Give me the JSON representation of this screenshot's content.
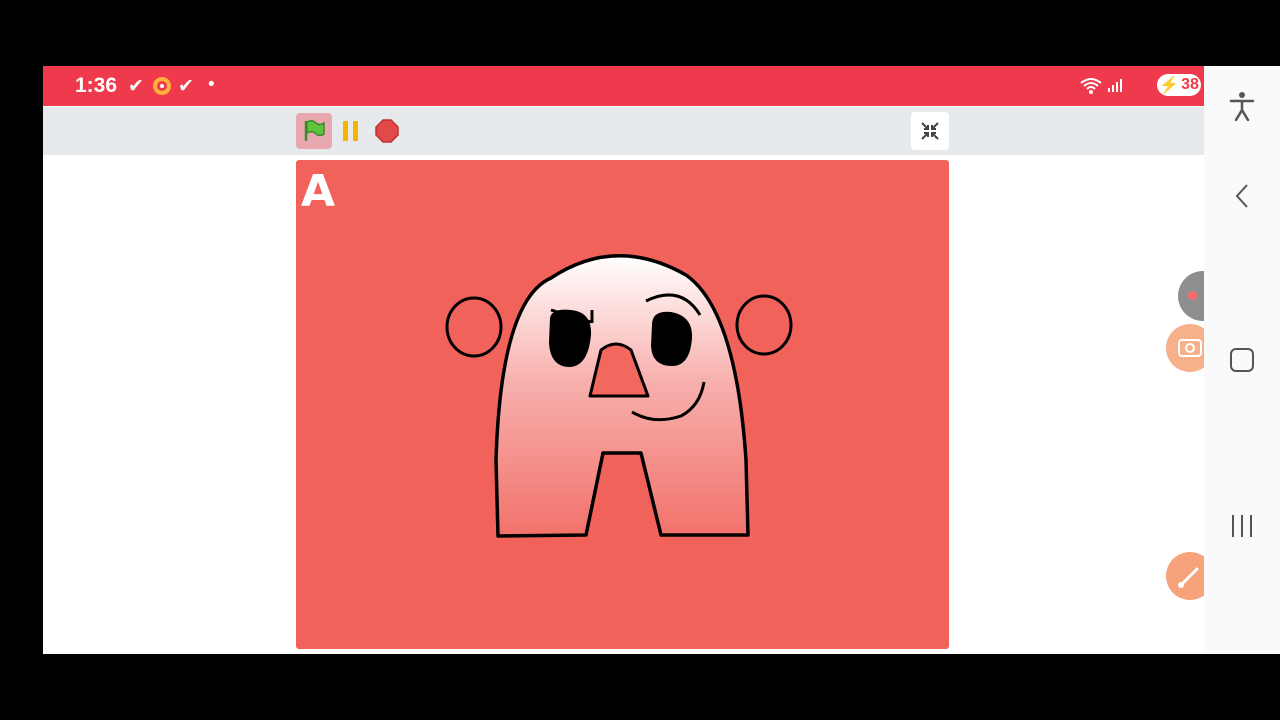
{
  "status_bar": {
    "time": "1:36",
    "notification_icons": [
      "check-icon",
      "screen-recorder-icon",
      "check-icon",
      "dot-icon"
    ],
    "battery_level": "38",
    "color": "#ef3a4e"
  },
  "toolbar": {
    "buttons": [
      "green-flag",
      "pause",
      "stop",
      "fullscreen-exit"
    ]
  },
  "stage": {
    "corner_letter": "A",
    "background_color": "#f1625b",
    "sprite": "letter-a-character"
  },
  "nav_bar": {
    "buttons": [
      "accessibility-icon",
      "back-icon",
      "home-icon",
      "recent-apps-icon"
    ]
  },
  "floating": {
    "buttons": [
      "screenshot-icon",
      "draw-icon"
    ]
  }
}
